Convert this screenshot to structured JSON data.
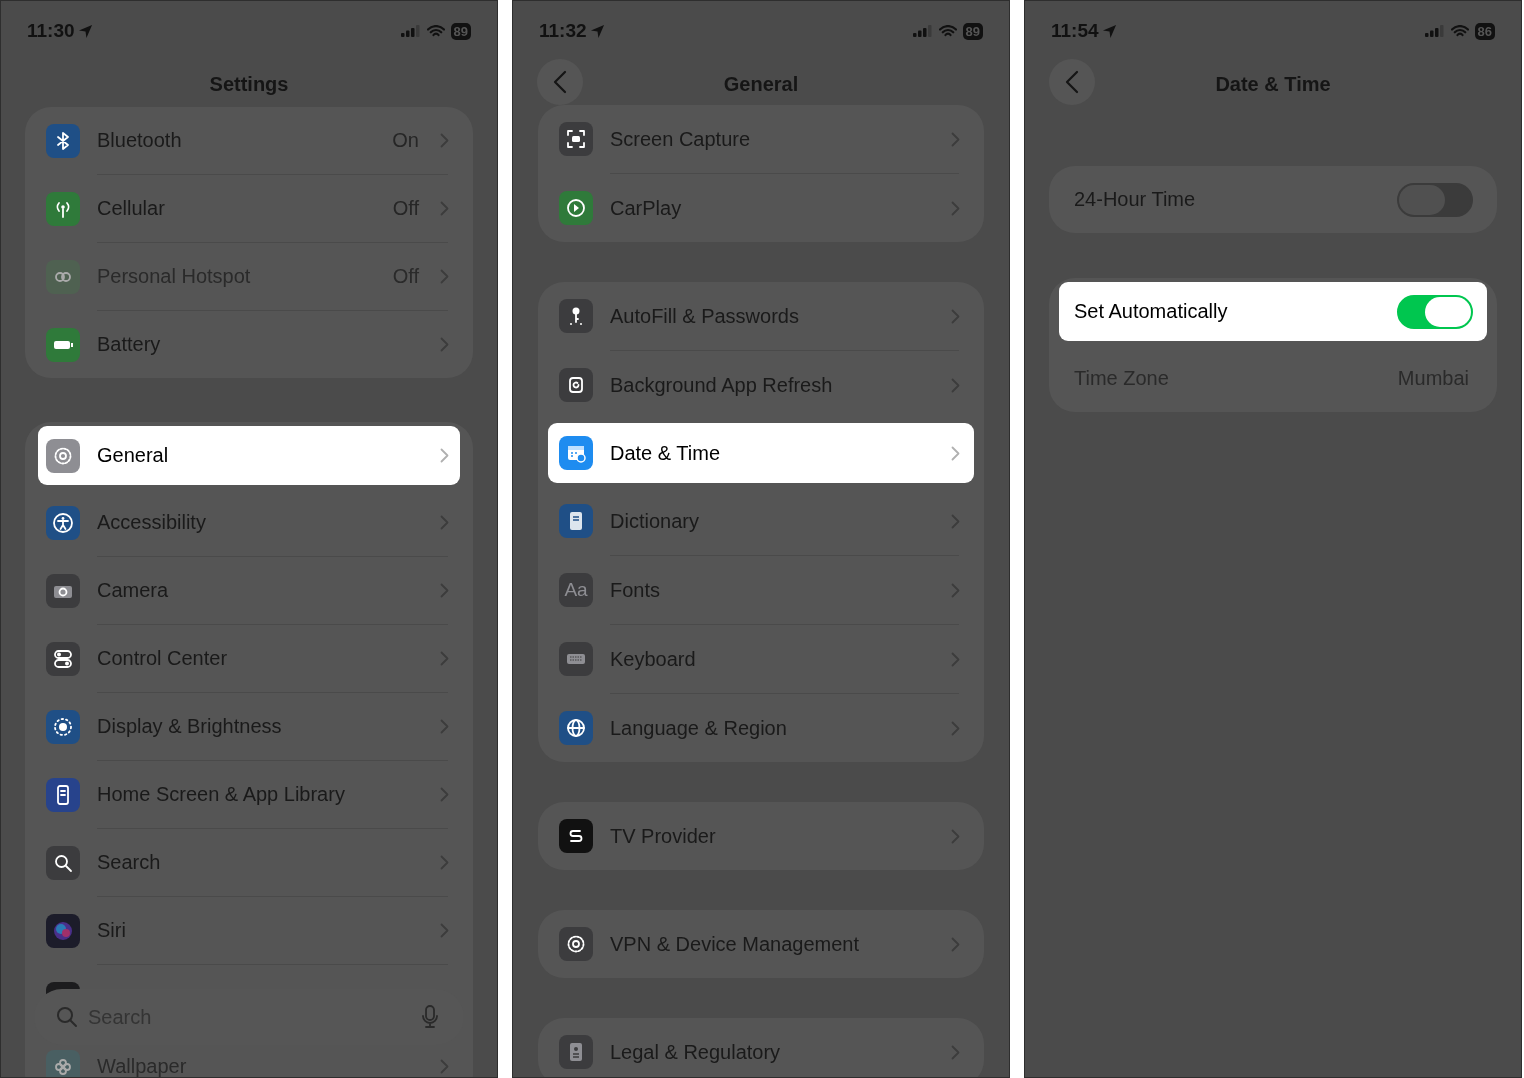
{
  "screens": [
    {
      "status": {
        "time": "11:30",
        "battery": "89"
      },
      "title": "Settings",
      "back": false,
      "groups": [
        {
          "rows": [
            {
              "kind": "link",
              "label": "Bluetooth",
              "value": "On",
              "color": "#1f4f86",
              "highlighted": false,
              "disabled": false
            },
            {
              "kind": "link",
              "label": "Cellular",
              "value": "Off",
              "color": "#2f7a3a",
              "highlighted": false,
              "disabled": false
            },
            {
              "kind": "link",
              "label": "Personal Hotspot",
              "value": "Off",
              "color": "#4a6e4e",
              "highlighted": false,
              "disabled": true
            },
            {
              "kind": "link",
              "label": "Battery",
              "color": "#2f7a3a",
              "highlighted": false,
              "disabled": false
            }
          ]
        },
        {
          "rows": [
            {
              "kind": "link",
              "label": "General",
              "color": "#8e8e93",
              "highlighted": true,
              "disabled": false
            },
            {
              "kind": "link",
              "label": "Accessibility",
              "color": "#1f4f86",
              "highlighted": false,
              "disabled": false
            },
            {
              "kind": "link",
              "label": "Camera",
              "color": "#3c3c3e",
              "highlighted": false,
              "disabled": false
            },
            {
              "kind": "link",
              "label": "Control Center",
              "color": "#3c3c3e",
              "highlighted": false,
              "disabled": false
            },
            {
              "kind": "link",
              "label": "Display & Brightness",
              "color": "#1f4f86",
              "highlighted": false,
              "disabled": false
            },
            {
              "kind": "link",
              "label": "Home Screen & App Library",
              "color": "#27438c",
              "highlighted": false,
              "disabled": false
            },
            {
              "kind": "link",
              "label": "Search",
              "color": "#3c3c3e",
              "highlighted": false,
              "disabled": false
            },
            {
              "kind": "link",
              "label": "Siri",
              "color": "#1c1c2a",
              "highlighted": false,
              "disabled": false
            },
            {
              "kind": "covered",
              "color": "#1c1c1e",
              "highlighted": false,
              "disabled": false
            },
            {
              "kind": "link",
              "label": "Wallpaper",
              "color": "#3e6a70",
              "highlighted": false,
              "disabled": true
            }
          ]
        }
      ],
      "search": {
        "placeholder": "Search"
      }
    },
    {
      "status": {
        "time": "11:32",
        "battery": "89"
      },
      "title": "General",
      "back": true,
      "groups": [
        {
          "rows": [
            {
              "kind": "link",
              "label": "Screen Capture",
              "color": "#3c3c3e",
              "highlighted": false,
              "disabled": false
            },
            {
              "kind": "link",
              "label": "CarPlay",
              "color": "#2f7a3a",
              "highlighted": false,
              "disabled": false
            }
          ]
        },
        {
          "rows": [
            {
              "kind": "link",
              "label": "AutoFill & Passwords",
              "color": "#3c3c3e",
              "highlighted": false,
              "disabled": false
            },
            {
              "kind": "link",
              "label": "Background App Refresh",
              "color": "#3c3c3e",
              "highlighted": false,
              "disabled": false
            },
            {
              "kind": "link",
              "label": "Date & Time",
              "color": "#1e8cf0",
              "highlighted": true,
              "disabled": false
            },
            {
              "kind": "link",
              "label": "Dictionary",
              "color": "#1f4f86",
              "highlighted": false,
              "disabled": false
            },
            {
              "kind": "link",
              "label": "Fonts",
              "icon_text": "Aa",
              "color": "#3c3c3e",
              "highlighted": false,
              "disabled": false
            },
            {
              "kind": "link",
              "label": "Keyboard",
              "color": "#3c3c3e",
              "highlighted": false,
              "disabled": false
            },
            {
              "kind": "link",
              "label": "Language & Region",
              "color": "#1f4f86",
              "highlighted": false,
              "disabled": false
            }
          ]
        },
        {
          "rows": [
            {
              "kind": "link",
              "label": "TV Provider",
              "color": "#111111",
              "highlighted": false,
              "disabled": false
            }
          ]
        },
        {
          "rows": [
            {
              "kind": "link",
              "label": "VPN & Device Management",
              "color": "#3c3c3e",
              "highlighted": false,
              "disabled": false
            }
          ]
        },
        {
          "rows": [
            {
              "kind": "link",
              "label": "Legal & Regulatory",
              "color": "#3c3c3e",
              "highlighted": false,
              "disabled": false
            }
          ]
        }
      ]
    },
    {
      "status": {
        "time": "11:54",
        "battery": "86"
      },
      "title": "Date & Time",
      "back": true,
      "groups": [
        {
          "rows": [
            {
              "kind": "toggle",
              "label": "24-Hour Time",
              "on": false,
              "highlighted": false,
              "disabled": false
            }
          ]
        },
        {
          "rows": [
            {
              "kind": "toggle",
              "label": "Set Automatically",
              "on": true,
              "highlighted": true,
              "disabled": false
            },
            {
              "kind": "link",
              "label": "Time Zone",
              "value": "Mumbai",
              "highlighted": false,
              "disabled": true
            }
          ]
        }
      ]
    }
  ]
}
